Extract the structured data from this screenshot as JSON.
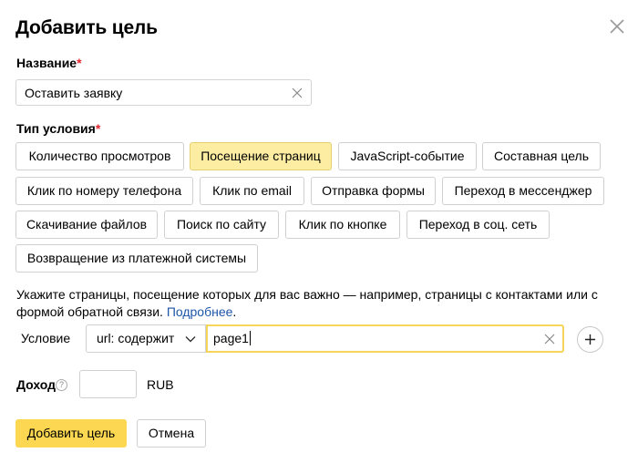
{
  "dialog": {
    "title": "Добавить цель"
  },
  "name_field": {
    "label": "Название",
    "required_mark": "*",
    "value": "Оставить заявку"
  },
  "condition_type": {
    "label": "Тип условия",
    "required_mark": "*",
    "options": [
      "Количество просмотров",
      "Посещение страниц",
      "JavaScript-событие",
      "Составная цель",
      "Клик по номеру телефона",
      "Клик по email",
      "Отправка формы",
      "Переход в мессенджер",
      "Скачивание файлов",
      "Поиск по сайту",
      "Клик по кнопке",
      "Переход в соц. сеть",
      "Возвращение из платежной системы"
    ],
    "selected": "Посещение страниц"
  },
  "hint": {
    "text": "Укажите страницы, посещение которых для вас важно — например, страницы с контактами или с формой обратной связи. ",
    "link": "Подробнее",
    "end": "."
  },
  "condition": {
    "label": "Условие",
    "operator": "url: содержит",
    "value": "page1"
  },
  "income": {
    "label": "Доход",
    "help": "?",
    "value": "",
    "currency": "RUB"
  },
  "actions": {
    "submit": "Добавить цель",
    "cancel": "Отмена"
  },
  "colors": {
    "accent": "#fcd852",
    "selected_chip": "#fdeda3",
    "required": "#e0262c",
    "link": "#1e56a8"
  }
}
